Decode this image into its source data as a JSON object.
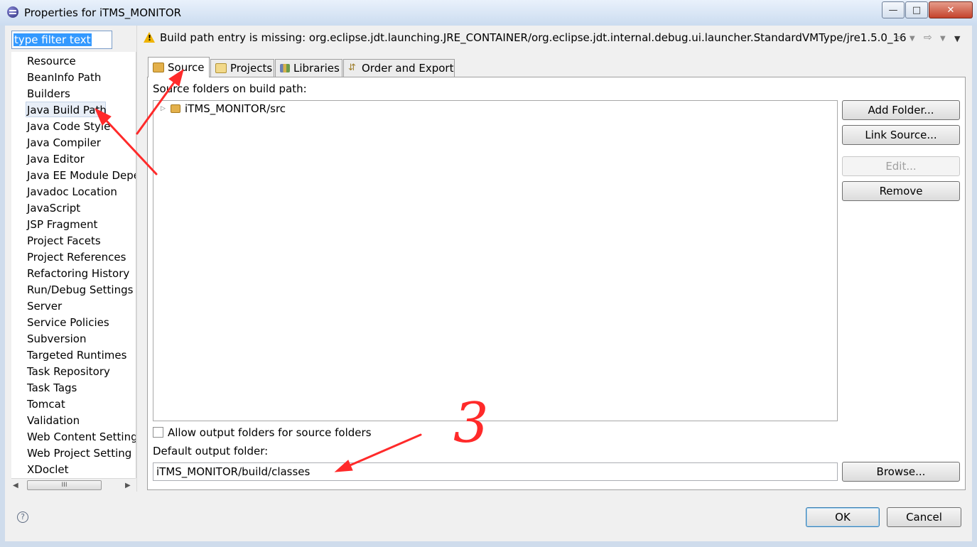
{
  "window": {
    "title": "Properties for iTMS_MONITOR",
    "controls": {
      "minimize": "—",
      "maximize": "□",
      "close": "✕"
    }
  },
  "filter": {
    "value": "type filter text"
  },
  "nav": {
    "items": [
      "Resource",
      "BeanInfo Path",
      "Builders",
      "Java Build Path",
      "Java Code Style",
      "Java Compiler",
      "Java Editor",
      "Java EE Module Depe",
      "Javadoc Location",
      "JavaScript",
      "JSP Fragment",
      "Project Facets",
      "Project References",
      "Refactoring History",
      "Run/Debug Settings",
      "Server",
      "Service Policies",
      "Subversion",
      "Targeted Runtimes",
      "Task Repository",
      "Task Tags",
      "Tomcat",
      "Validation",
      "Web Content Setting",
      "Web Project Setting",
      "XDoclet"
    ],
    "selected": "Java Build Path",
    "scrollbar_grip": "III"
  },
  "message": {
    "text": "Build path entry is missing: org.eclipse.jdt.launching.JRE_CONTAINER/org.eclipse.jdt.internal.debug.ui.launcher.StandardVMType/jre1.5.0_16",
    "icon": "warning-icon"
  },
  "tabs": [
    {
      "label": "Source",
      "icon": "folder-source-icon",
      "active": true
    },
    {
      "label": "Projects",
      "icon": "projects-icon",
      "active": false
    },
    {
      "label": "Libraries",
      "icon": "libraries-icon",
      "active": false
    },
    {
      "label": "Order and Export",
      "icon": "order-export-icon",
      "active": false
    }
  ],
  "source": {
    "label": "Source folders on build path:",
    "folders": [
      "iTMS_MONITOR/src"
    ],
    "buttons": {
      "add_folder": "Add Folder...",
      "link_source": "Link Source...",
      "edit": "Edit...",
      "remove": "Remove",
      "browse": "Browse..."
    },
    "allow_output_label": "Allow output folders for source folders",
    "allow_output_checked": false,
    "output_label": "Default output folder:",
    "output_value": "iTMS_MONITOR/build/classes"
  },
  "footer": {
    "help": "?",
    "ok": "OK",
    "cancel": "Cancel"
  },
  "annotation": {
    "text": "3",
    "color": "#ff2a2a"
  },
  "colors": {
    "accent": "#3399ff",
    "selection": "#e8eef7",
    "warning": "#f0b400"
  }
}
